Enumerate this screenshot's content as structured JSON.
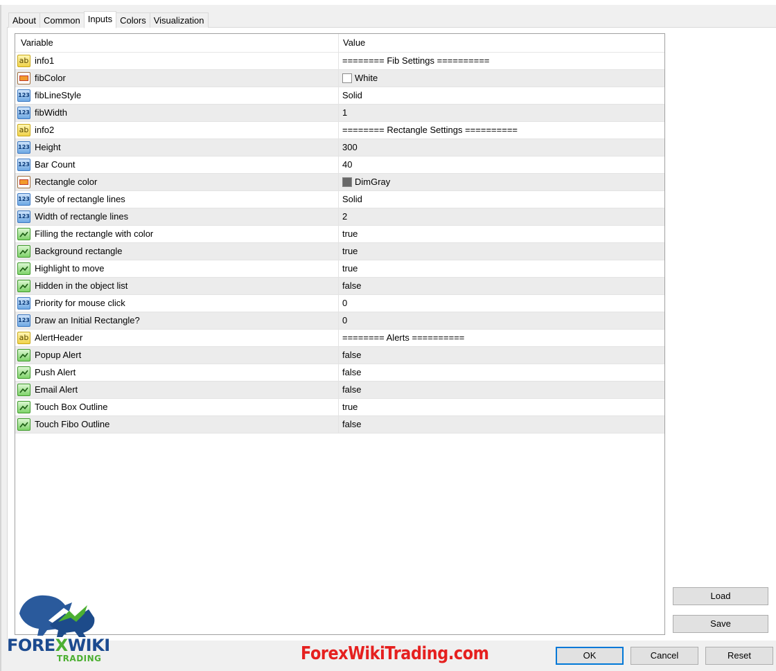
{
  "tabs": [
    {
      "label": "About",
      "active": false
    },
    {
      "label": "Common",
      "active": false
    },
    {
      "label": "Inputs",
      "active": true
    },
    {
      "label": "Colors",
      "active": false
    },
    {
      "label": "Visualization",
      "active": false
    }
  ],
  "grid": {
    "header": {
      "variable": "Variable",
      "value": "Value"
    },
    "rows": [
      {
        "name": "info1",
        "type": "string-icon",
        "value": "======== Fib Settings =========="
      },
      {
        "name": "fibColor",
        "type": "color-icon",
        "value": "White",
        "swatch": "#ffffff"
      },
      {
        "name": "fibLineStyle",
        "type": "number-icon",
        "value": "Solid"
      },
      {
        "name": "fibWidth",
        "type": "number-icon",
        "value": "1"
      },
      {
        "name": "info2",
        "type": "string-icon",
        "value": "======== Rectangle Settings =========="
      },
      {
        "name": "Height",
        "type": "number-icon",
        "value": "300"
      },
      {
        "name": "Bar Count",
        "type": "number-icon",
        "value": "40"
      },
      {
        "name": "Rectangle color",
        "type": "color-icon",
        "value": "DimGray",
        "swatch": "#696969"
      },
      {
        "name": "Style of rectangle lines",
        "type": "number-icon",
        "value": "Solid"
      },
      {
        "name": "Width of rectangle lines",
        "type": "number-icon",
        "value": "2"
      },
      {
        "name": "Filling the rectangle with color",
        "type": "bool-icon",
        "value": "true"
      },
      {
        "name": "Background rectangle",
        "type": "bool-icon",
        "value": "true"
      },
      {
        "name": "Highlight to move",
        "type": "bool-icon",
        "value": "true"
      },
      {
        "name": "Hidden in the object list",
        "type": "bool-icon",
        "value": "false"
      },
      {
        "name": "Priority for mouse click",
        "type": "number-icon",
        "value": "0"
      },
      {
        "name": "Draw an Initial Rectangle?",
        "type": "number-icon",
        "value": "0"
      },
      {
        "name": "AlertHeader",
        "type": "string-icon",
        "value": "======== Alerts =========="
      },
      {
        "name": "Popup Alert",
        "type": "bool-icon",
        "value": "false"
      },
      {
        "name": "Push Alert",
        "type": "bool-icon",
        "value": "false"
      },
      {
        "name": "Email Alert",
        "type": "bool-icon",
        "value": "false"
      },
      {
        "name": "Touch Box Outline",
        "type": "bool-icon",
        "value": "true"
      },
      {
        "name": "Touch Fibo Outline",
        "type": "bool-icon",
        "value": "false"
      }
    ]
  },
  "buttons": {
    "load": "Load",
    "save": "Save",
    "ok": "OK",
    "cancel": "Cancel",
    "reset": "Reset"
  },
  "branding": {
    "logo_forex": "FORE",
    "logo_x": "X",
    "logo_wiki": "WIKI",
    "logo_trading": "TRADING",
    "watermark": "ForexWikiTrading.com"
  },
  "colors": {
    "accent": "#0078d7",
    "watermark": "#e5201f",
    "logo_blue": "#1b4a8f",
    "logo_green": "#4caf32"
  }
}
